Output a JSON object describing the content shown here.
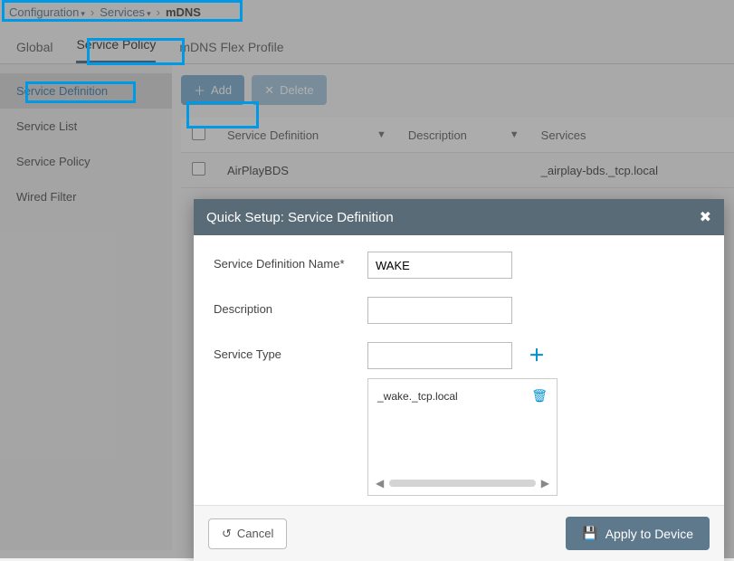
{
  "breadcrumb": {
    "configuration": "Configuration",
    "services": "Services",
    "mdns": "mDNS"
  },
  "tabs": {
    "global": "Global",
    "service_policy": "Service Policy",
    "mdns_flex": "mDNS Flex Profile"
  },
  "sidebar": {
    "items": [
      {
        "label": "Service Definition"
      },
      {
        "label": "Service List"
      },
      {
        "label": "Service Policy"
      },
      {
        "label": "Wired Filter"
      }
    ]
  },
  "toolbar": {
    "add": "Add",
    "delete": "Delete"
  },
  "table": {
    "headers": {
      "service_definition": "Service Definition",
      "description": "Description",
      "services": "Services"
    },
    "row": {
      "name": "AirPlayBDS",
      "description": "",
      "services": "_airplay-bds._tcp.local"
    }
  },
  "modal": {
    "title": "Quick Setup: Service Definition",
    "labels": {
      "name": "Service Definition Name*",
      "description": "Description",
      "service_type": "Service Type"
    },
    "values": {
      "name": "WAKE",
      "description": "",
      "service_type": ""
    },
    "entries": [
      "_wake._tcp.local"
    ],
    "cancel": "Cancel",
    "apply": "Apply to Device"
  }
}
